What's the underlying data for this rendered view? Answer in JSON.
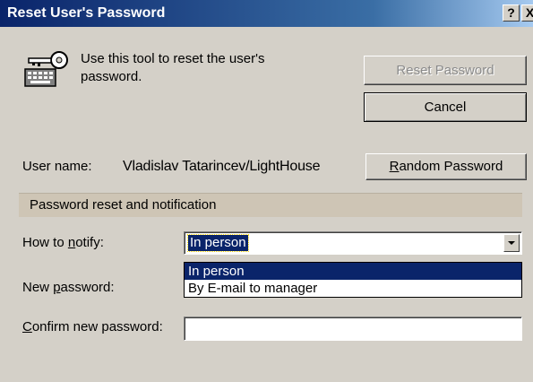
{
  "window": {
    "title": "Reset User's Password",
    "help_glyph": "?",
    "close_glyph": "X"
  },
  "intro": {
    "icon": "key-keyboard-icon",
    "description": "Use this tool to reset the user's password."
  },
  "buttons": {
    "reset_password": "Reset Password",
    "cancel": "Cancel",
    "random_password_mnemonic": "R",
    "random_password_rest": "andom Password"
  },
  "user": {
    "label": "User name:",
    "value": "Vladislav Tatarincev/LightHouse"
  },
  "section": {
    "title": "Password reset and notification"
  },
  "notify": {
    "label_pre": "How to ",
    "label_mnemonic": "n",
    "label_post": "otify:",
    "selected": "In person",
    "options": [
      "In person",
      "By E-mail to manager"
    ]
  },
  "new_password": {
    "label_pre": "New ",
    "label_mnemonic": "p",
    "label_post": "assword:"
  },
  "confirm_password": {
    "label_mnemonic": "C",
    "label_post": "onfirm new password:",
    "value": ""
  },
  "colors": {
    "title_bar": "#0a246a",
    "face": "#d4d0c8",
    "selection": "#0a246a",
    "section_header": "#cec5b5"
  }
}
